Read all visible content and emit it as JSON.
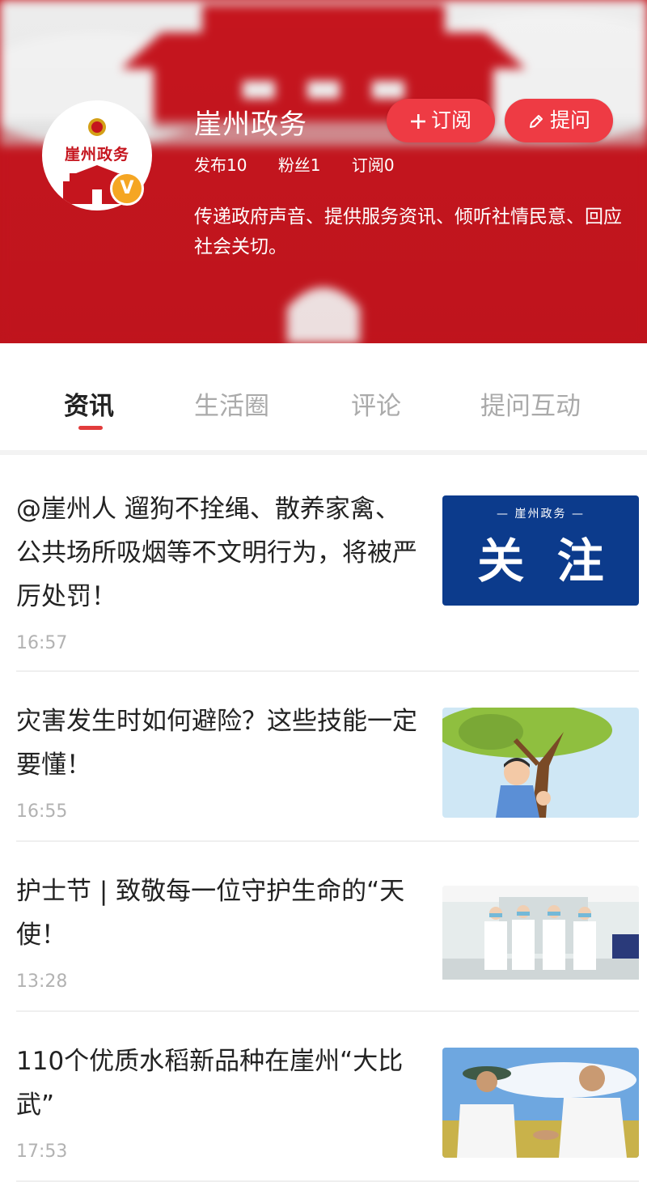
{
  "account": {
    "name": "崖州政务",
    "avatar_text": "崖州政务",
    "verified_badge": "V",
    "stats": {
      "publish": "发布10",
      "fans": "粉丝1",
      "subscriptions": "订阅0"
    },
    "intro": "传递政府声音、提供服务资讯、倾听社情民意、回应社会关切。"
  },
  "actions": {
    "subscribe_label": "订阅",
    "subscribe_icon": "plus-icon",
    "ask_label": "提问",
    "ask_icon": "pencil-icon"
  },
  "tabs": [
    {
      "label": "资讯",
      "active": true
    },
    {
      "label": "生活圈",
      "active": false
    },
    {
      "label": "评论",
      "active": false
    },
    {
      "label": "提问互动",
      "active": false
    }
  ],
  "news": [
    {
      "title": "@崖州人 遛狗不拴绳、散养家禽、公共场所吸烟等不文明行为，将被严厉处罚！",
      "time": "16:57",
      "thumb_caption_small": "— 崖州政务 —",
      "thumb_caption_large": "关  注"
    },
    {
      "title": "灾害发生时如何避险？这些技能一定要懂！",
      "time": "16:55"
    },
    {
      "title": "护士节 | 致敬每一位守护生命的“天使！",
      "time": "13:28"
    },
    {
      "title": "110个优质水稻新品种在崖州“大比武”",
      "time": "17:53"
    }
  ],
  "colors": {
    "brand_red": "#c5151e",
    "button_red": "#ee3b44",
    "badge_gold": "#f5a623",
    "tab_indicator": "#e23c3c",
    "thumb_navy": "#0c3b8c"
  }
}
